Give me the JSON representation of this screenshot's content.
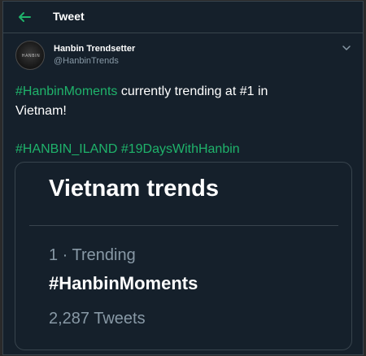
{
  "header": {
    "title": "Tweet",
    "back_icon": "arrow-left-icon"
  },
  "author": {
    "display_name": "Hanbin Trendsetter",
    "handle": "@HanbinTrends",
    "avatar_mark": "HANBIN"
  },
  "tweet": {
    "hashtag_1": "#HanbinMoments",
    "text_rest_line1": " currently trending at #1 in",
    "text_line2": "Vietnam!",
    "hashtags_line": "#HANBIN_ILAND #19DaysWithHanbin"
  },
  "card": {
    "title": "Vietnam trends",
    "rank_label": "1 · Trending",
    "hashtag": "#HanbinMoments",
    "tweet_count": "2,287 Tweets"
  },
  "colors": {
    "accent": "#1fb36b",
    "background": "#15202b",
    "secondary_text": "#8899a6",
    "border": "#38444d"
  }
}
